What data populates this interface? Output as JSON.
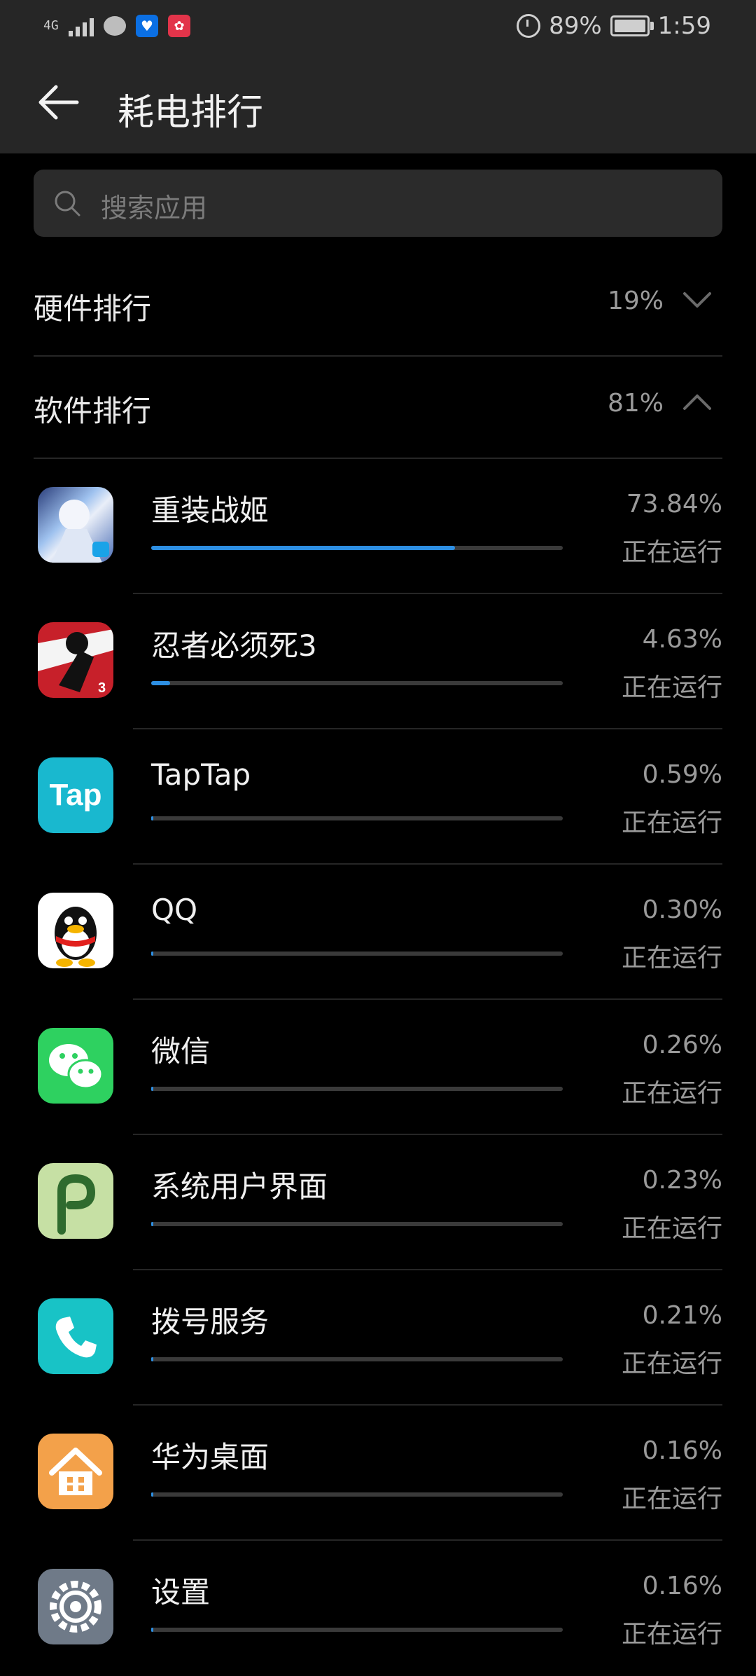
{
  "status_bar": {
    "network": "4G",
    "battery": "89%",
    "battery_level": 0.89,
    "time": "1:59"
  },
  "header": {
    "title": "耗电排行"
  },
  "search": {
    "placeholder": "搜索应用"
  },
  "sections": [
    {
      "label": "硬件排行",
      "percent": "19%",
      "expanded": false
    },
    {
      "label": "软件排行",
      "percent": "81%",
      "expanded": true
    }
  ],
  "apps": [
    {
      "name": "重装战姬",
      "percent": "73.84%",
      "status": "正在运行",
      "share": 0.7384,
      "icon": "game-icon"
    },
    {
      "name": "忍者必须死3",
      "percent": "4.63%",
      "status": "正在运行",
      "share": 0.0463,
      "icon": "ninja-icon"
    },
    {
      "name": "TapTap",
      "percent": "0.59%",
      "status": "正在运行",
      "share": 0.0059,
      "icon": "taptap-icon",
      "icon_text": "Tap"
    },
    {
      "name": "QQ",
      "percent": "0.30%",
      "status": "正在运行",
      "share": 0.003,
      "icon": "qq-icon"
    },
    {
      "name": "微信",
      "percent": "0.26%",
      "status": "正在运行",
      "share": 0.0026,
      "icon": "wechat-icon"
    },
    {
      "name": "系统用户界面",
      "percent": "0.23%",
      "status": "正在运行",
      "share": 0.0023,
      "icon": "android-icon"
    },
    {
      "name": "拨号服务",
      "percent": "0.21%",
      "status": "正在运行",
      "share": 0.0021,
      "icon": "phone-icon"
    },
    {
      "name": "华为桌面",
      "percent": "0.16%",
      "status": "正在运行",
      "share": 0.0016,
      "icon": "home-icon"
    },
    {
      "name": "设置",
      "percent": "0.16%",
      "status": "正在运行",
      "share": 0.0016,
      "icon": "settings-icon"
    }
  ],
  "colors": {
    "accent": "#2d8fe3",
    "background": "#000000",
    "header_bg": "#262626"
  }
}
